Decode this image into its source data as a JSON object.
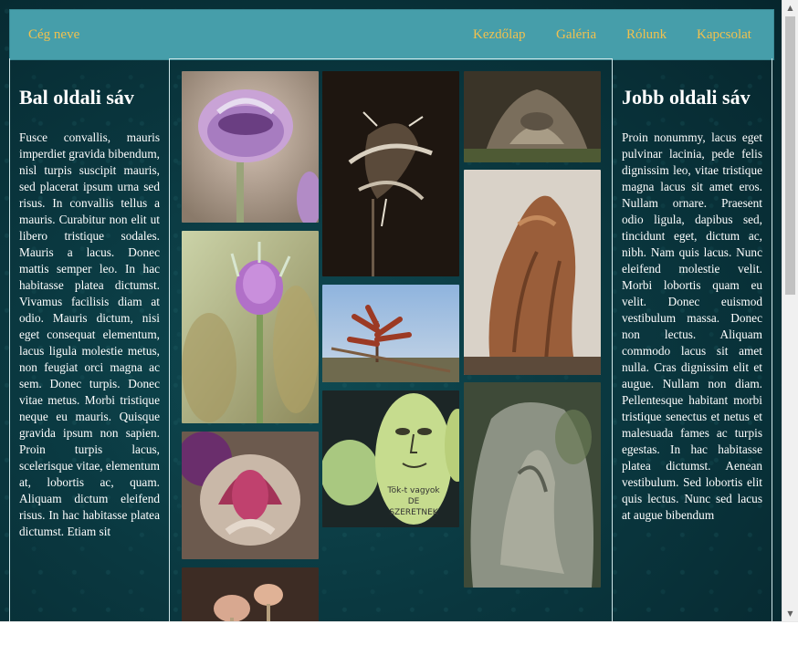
{
  "navbar": {
    "brand": "Cég neve",
    "items": [
      "Kezdőlap",
      "Galéria",
      "Rólunk",
      "Kapcsolat"
    ]
  },
  "left_sidebar": {
    "title": "Bal oldali sáv",
    "text": "Fusce convallis, mauris imperdiet gravida bibendum, nisl turpis suscipit mauris, sed placerat ipsum urna sed risus. In convallis tellus a mauris. Curabitur non elit ut libero tristique sodales. Mauris a lacus. Donec mattis semper leo. In hac habitasse platea dictumst. Vivamus facilisis diam at odio. Mauris dictum, nisi eget consequat elementum, lacus ligula molestie metus, non feugiat orci magna ac sem. Donec turpis. Donec vitae metus. Morbi tristique neque eu mauris. Quisque gravida ipsum non sapien. Proin turpis lacus, scelerisque vitae, elementum at, lobortis ac, quam. Aliquam dictum eleifend risus. In hac habitasse platea dictumst. Etiam sit"
  },
  "right_sidebar": {
    "title": "Jobb oldali sáv",
    "text": "Proin nonummy, lacus eget pulvinar lacinia, pede felis dignissim leo, vitae tristique magna lacus sit amet eros. Nullam ornare. Praesent odio ligula, dapibus sed, tincidunt eget, dictum ac, nibh. Nam quis lacus. Nunc eleifend molestie velit. Morbi lobortis quam eu velit. Donec euismod vestibulum massa. Donec non lectus. Aliquam commodo lacus sit amet nulla. Cras dignissim elit et augue. Nullam non diam. Pellentesque habitant morbi tristique senectus et netus et malesuada fames ac turpis egestas. In hac habitasse platea dictumst. Aenean vestibulum. Sed lobortis elit quis lectus. Nunc sed lacus at augue bibendum"
  },
  "gallery": {
    "photos": [
      "purple-pasque-flower-closeup",
      "milkweed-seed-pod",
      "mossy-tree-stump",
      "purple-pasque-flower-bud",
      "red-spring-shoots",
      "brown-bark-fungus",
      "red-pasque-flower-open",
      "carved-melon-face",
      "gnarled-tree-trunk",
      "pasque-flower-buds"
    ],
    "melon_text": "Tök-t vagyok DE SZERETNEK"
  },
  "colors": {
    "navbar": "#469eaa",
    "nav_text": "#f2c14e",
    "background": "#0a3840"
  }
}
